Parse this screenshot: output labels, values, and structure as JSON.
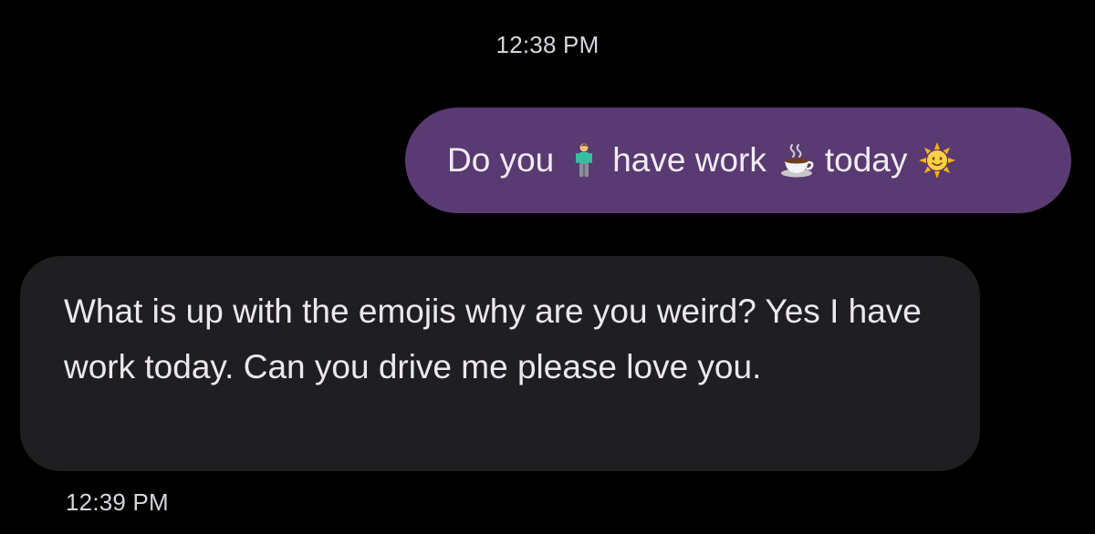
{
  "conversation": {
    "sent_time": "12:38 PM",
    "sent_message": {
      "parts": [
        {
          "type": "text",
          "value": "Do you"
        },
        {
          "type": "emoji",
          "icon": "person-standing-icon"
        },
        {
          "type": "text",
          "value": "have work"
        },
        {
          "type": "emoji",
          "icon": "hot-beverage-icon"
        },
        {
          "type": "text",
          "value": "today"
        },
        {
          "type": "emoji",
          "icon": "sun-with-face-icon"
        }
      ]
    },
    "received_message": {
      "text": "What is up with the emojis why are you weird? Yes I have work today. Can you drive me please love you."
    },
    "received_time": "12:39 PM"
  },
  "colors": {
    "background": "#000000",
    "sent_bubble": "#5a3a72",
    "received_bubble": "#1f1f21",
    "text": "#ede7ef"
  }
}
